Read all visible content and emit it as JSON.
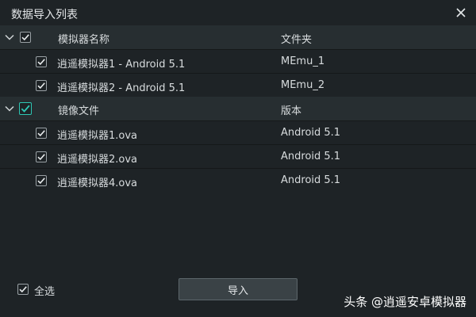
{
  "window": {
    "title": "数据导入列表"
  },
  "groups": [
    {
      "name_header": "模拟器名称",
      "col2_header": "文件夹",
      "items": [
        {
          "name": "逍遥模拟器1 - Android 5.1",
          "value": "MEmu_1"
        },
        {
          "name": "逍遥模拟器2 - Android 5.1",
          "value": "MEmu_2"
        }
      ]
    },
    {
      "name_header": "镜像文件",
      "col2_header": "版本",
      "items": [
        {
          "name": "逍遥模拟器1.ova",
          "value": "Android 5.1"
        },
        {
          "name": "逍遥模拟器2.ova",
          "value": "Android 5.1"
        },
        {
          "name": "逍遥模拟器4.ova",
          "value": "Android 5.1"
        }
      ]
    }
  ],
  "footer": {
    "select_all_label": "全选",
    "import_label": "导入",
    "watermark": "头条 @逍遥安卓模拟器"
  },
  "colors": {
    "accent": "#2ec7b4",
    "background": "#1e2326",
    "header_row": "#272e31"
  }
}
